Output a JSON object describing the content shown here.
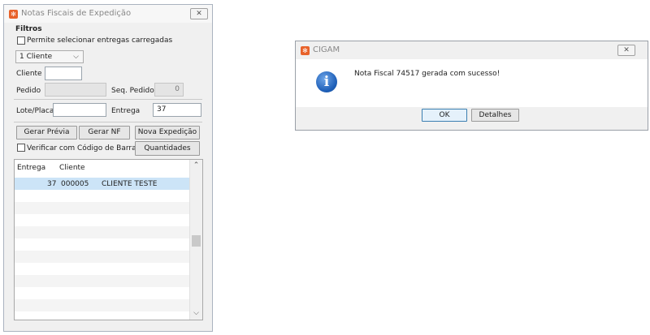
{
  "main_window": {
    "title": "Notas Fiscais de Expedição",
    "filters_label": "Filtros",
    "allow_loaded_label": "Permite selecionar entregas carregadas",
    "selector_value": "1 Cliente",
    "cliente_label": "Cliente",
    "cliente_value": "",
    "pedido_label": "Pedido",
    "pedido_value": "",
    "seq_pedido_label": "Seq. Pedido",
    "seq_pedido_value": "0",
    "lote_label": "Lote/Placa",
    "lote_value": "",
    "entrega_label": "Entrega",
    "entrega_value": "37",
    "btn_gerar_previa": "Gerar Prévia",
    "btn_gerar_nf": "Gerar NF",
    "btn_nova_expedicao": "Nova Expedição",
    "verify_barcode_label": "Verificar com Código de Barras",
    "btn_quantidades": "Quantidades",
    "grid": {
      "columns": [
        "Entrega",
        "Cliente"
      ],
      "rows": [
        {
          "entrega": "37",
          "codigo": "000005",
          "nome": "CLIENTE TESTE"
        }
      ]
    }
  },
  "dialog": {
    "title": "CIGAM",
    "message": "Nota Fiscal 74517 gerada com sucesso!",
    "ok_label": "OK",
    "details_label": "Detalhes"
  },
  "colors": {
    "selection": "#cce4f7",
    "accent_icon": "#e8622a",
    "info_icon": "#1e5fb8"
  }
}
